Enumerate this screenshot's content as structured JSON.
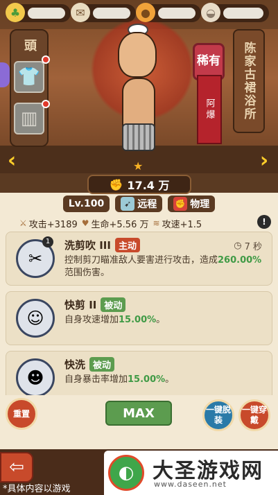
{
  "resources": [
    {
      "icon": "clover-coin-icon"
    },
    {
      "icon": "scroll-icon"
    },
    {
      "icon": "gold-bag-icon"
    },
    {
      "icon": "bun-icon"
    }
  ],
  "equipment": {
    "tag": "頭"
  },
  "character": {
    "rarity": "稀有",
    "name": "阿爆",
    "banner": "陈家古裙浴所"
  },
  "power": {
    "value": "17.4 万"
  },
  "tags": {
    "level": "Lv.100",
    "range": "远程",
    "damage": "物理"
  },
  "stats": {
    "attack": "攻击+3189",
    "health": "生命+5.56 万",
    "speed": "攻速+1.5"
  },
  "skills": [
    {
      "title": "洗剪吹 III",
      "type": "主动",
      "level": "1",
      "cooldown": "7 秒",
      "desc_pre": "控制剪刀瞄准敌人要害进行攻击，造成",
      "highlight": "260.00%",
      "desc_post": "范围伤害。"
    },
    {
      "title": "快剪 II",
      "type": "被动",
      "desc_pre": "自身攻速增加",
      "highlight": "15.00%",
      "desc_post": "。"
    },
    {
      "title": "快洗",
      "type": "被动",
      "desc_pre": "自身暴击率增加",
      "highlight": "15.00%",
      "desc_post": "。"
    }
  ],
  "buttons": {
    "reset": "重置",
    "max": "MAX",
    "unequip": "一键脱装",
    "equip": "一键穿戴"
  },
  "footer": {
    "note": "*具体内容以游戏"
  },
  "watermark": {
    "title": "大圣游戏网",
    "url": "www.daseen.net"
  }
}
